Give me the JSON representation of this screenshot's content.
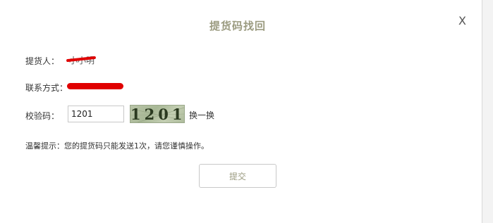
{
  "dialog": {
    "title": "提货码找回",
    "close_label": "X"
  },
  "form": {
    "receiver_label": "提货人：",
    "receiver_value": "小小明",
    "contact_label": "联系方式：",
    "captcha_label": "校验码：",
    "captcha_input_value": "1201",
    "captcha_image_text": "1201",
    "refresh_label": "换一换",
    "tip": "温馨提示：您的提货码只能发送1次，请您谨慎操作。",
    "submit_label": "提交"
  },
  "colors": {
    "title": "#9b9b80",
    "redaction": "#e00000",
    "captcha_bg": "#b9c4a8"
  }
}
